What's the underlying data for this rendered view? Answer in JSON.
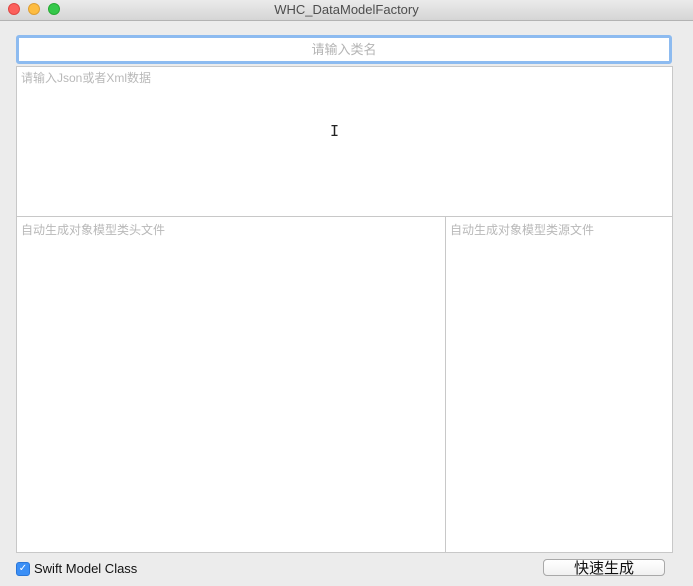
{
  "window": {
    "title": "WHC_DataModelFactory"
  },
  "class_name_field": {
    "placeholder": "请输入类名",
    "value": ""
  },
  "json_input": {
    "placeholder": "请输入Json或者Xml数据",
    "value": ""
  },
  "header_output": {
    "placeholder": "自动生成对象模型类头文件",
    "value": ""
  },
  "source_output": {
    "placeholder": "自动生成对象模型类源文件",
    "value": ""
  },
  "swift_option": {
    "label": "Swift Model Class",
    "checked": true
  },
  "generate_button": {
    "label": "快速生成"
  },
  "cursor": {
    "glyph": "I"
  },
  "colors": {
    "focus_ring": "#8dbbf0",
    "checkbox_fill": "#3b8ff6",
    "close": "#fc605c",
    "minimize": "#fdbc40",
    "maximize": "#34c84a"
  }
}
